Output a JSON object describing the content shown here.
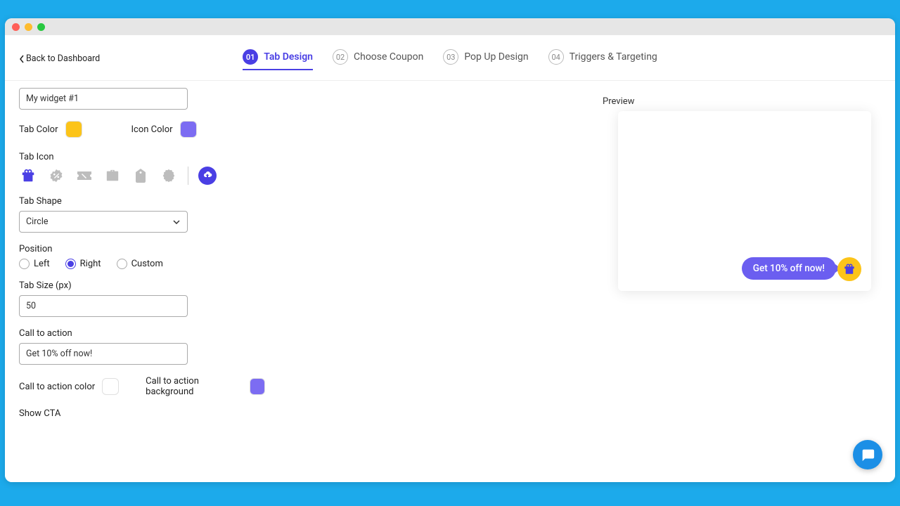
{
  "back_label": "Back to Dashboard",
  "steps": [
    {
      "num": "01",
      "label": "Tab Design"
    },
    {
      "num": "02",
      "label": "Choose Coupon"
    },
    {
      "num": "03",
      "label": "Pop Up Design"
    },
    {
      "num": "04",
      "label": "Triggers & Targeting"
    }
  ],
  "form": {
    "name_value": "My widget #1",
    "tab_color_label": "Tab Color",
    "icon_color_label": "Icon Color",
    "tab_icon_label": "Tab Icon",
    "tab_shape_label": "Tab Shape",
    "tab_shape_value": "Circle",
    "position_label": "Position",
    "position_options": {
      "left": "Left",
      "right": "Right",
      "custom": "Custom"
    },
    "tab_size_label": "Tab Size (px)",
    "tab_size_value": "50",
    "cta_label": "Call to action",
    "cta_value": "Get 10% off now!",
    "cta_color_label": "Call to action color",
    "cta_bg_label": "Call to action background",
    "show_cta_label": "Show CTA"
  },
  "preview": {
    "label": "Preview",
    "cta_text": "Get 10% off now!"
  },
  "colors": {
    "tab": "#fcc419",
    "icon": "#7c6cf2",
    "cta_text": "#ffffff",
    "cta_bg": "#7c6cf2"
  }
}
